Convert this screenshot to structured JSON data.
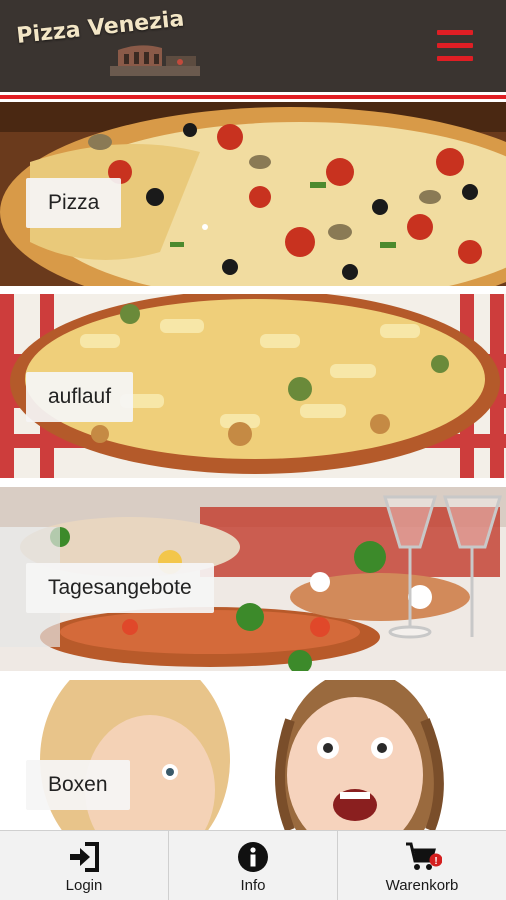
{
  "header": {
    "logo_text": "Pizza Venezia",
    "menu_icon": "hamburger-menu-icon",
    "accent_color": "#e01e24",
    "background_color": "#3a3430"
  },
  "categories": [
    {
      "label": "Pizza"
    },
    {
      "label": "auflauf"
    },
    {
      "label": "Tagesangebote"
    },
    {
      "label": "Boxen"
    }
  ],
  "tabbar": {
    "items": [
      {
        "label": "Login",
        "icon": "login-icon"
      },
      {
        "label": "Info",
        "icon": "info-icon"
      },
      {
        "label": "Warenkorb",
        "icon": "shopping-cart-icon",
        "badge": "!"
      }
    ]
  }
}
